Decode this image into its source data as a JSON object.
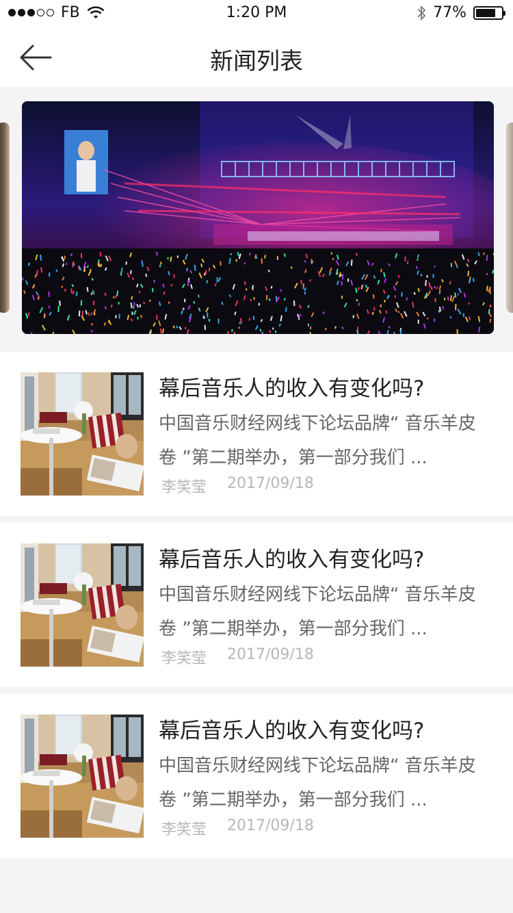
{
  "status_bar": {
    "carrier": "FB",
    "time": "1:20 PM",
    "battery": "77%",
    "battery_level": 0.77
  },
  "nav": {
    "title": "新闻列表",
    "back_icon": "arrow-left-icon"
  },
  "carousel": {
    "banner_alt": "concert-stage-image"
  },
  "news": [
    {
      "title": "幕后音乐人的收入有变化吗?",
      "summary": "中国音乐财经网线下论坛品牌“ 音乐羊皮卷 ”第二期举办，第一部分我们 ...",
      "author": "李笑莹",
      "date": "2017/09/18"
    },
    {
      "title": "幕后音乐人的收入有变化吗?",
      "summary": "中国音乐财经网线下论坛品牌“ 音乐羊皮卷 ”第二期举办，第一部分我们 ...",
      "author": "李笑莹",
      "date": "2017/09/18"
    },
    {
      "title": "幕后音乐人的收入有变化吗?",
      "summary": "中国音乐财经网线下论坛品牌“ 音乐羊皮卷 ”第二期举办，第一部分我们 ...",
      "author": "李笑莹",
      "date": "2017/09/18"
    }
  ]
}
